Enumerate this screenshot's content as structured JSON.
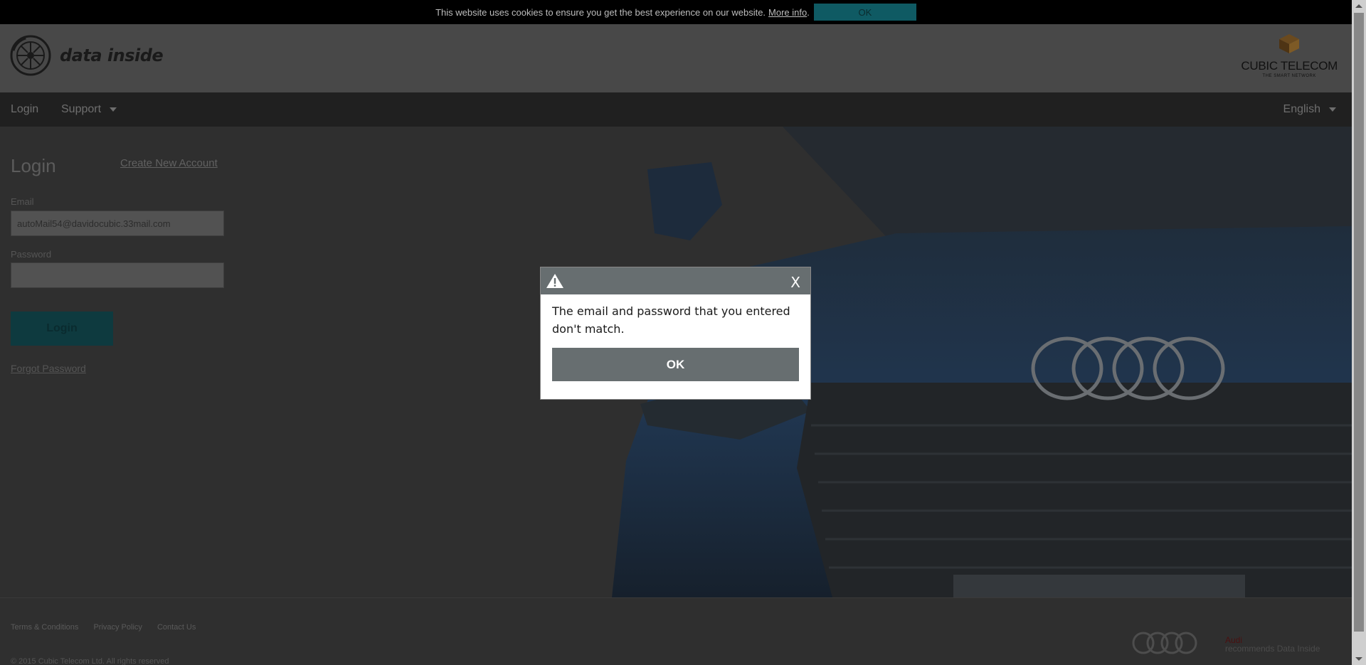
{
  "cookie_bar": {
    "message": "This website uses cookies to ensure you get the best experience on our website.",
    "more_info": "More info",
    "ok_label": "OK"
  },
  "header": {
    "app_name": "data inside",
    "partner_name": "CUBIC TELECOM",
    "partner_tagline": "THE SMART NETWORK"
  },
  "nav": {
    "login": "Login",
    "support": "Support",
    "language": "English"
  },
  "login_form": {
    "title": "Login",
    "create_account": "Create New Account",
    "email_label": "Email",
    "email_value": "autoMail54@davidocubic.33mail.com",
    "password_label": "Password",
    "login_button": "Login",
    "forgot_password": "Forgot Password"
  },
  "footer": {
    "terms": "Terms & Conditions",
    "privacy": "Privacy Policy",
    "contact": "Contact Us",
    "copyright": "© 2015 Cubic Telecom Ltd. All rights reserved",
    "audi_brand": "Audi",
    "audi_text": "recommends Data Inside"
  },
  "dialog": {
    "close_label": "X",
    "message": "The email and password that you entered don't match.",
    "ok_label": "OK"
  },
  "colors": {
    "overlay": "#2f2f2f",
    "accent_teal": "#0f5a63",
    "dialog_gray": "#676e70"
  }
}
